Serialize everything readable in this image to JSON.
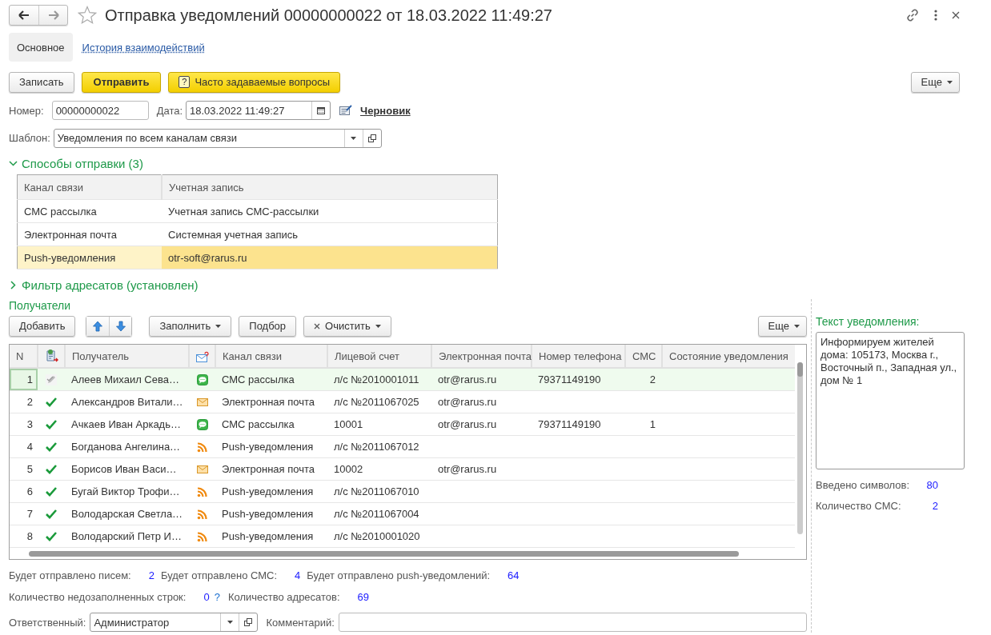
{
  "window": {
    "title": "Отправка уведомлений 00000000022 от 18.03.2022 11:49:27",
    "favorite": false
  },
  "tabs": [
    {
      "label": "Основное",
      "selected": true
    },
    {
      "label": "История взаимодействий",
      "selected": false
    }
  ],
  "toolbar": {
    "buttons": [
      {
        "label": "Записать",
        "kind": "plain"
      },
      {
        "label": "Отправить",
        "kind": "primary"
      },
      {
        "label": "Часто задаваемые вопросы",
        "kind": "help",
        "icon": "?"
      }
    ],
    "more": "Еще"
  },
  "number": {
    "label": "Номер:",
    "value": "00000000022"
  },
  "date": {
    "label": "Дата:",
    "value": "18.03.2022 11:49:27"
  },
  "state_link": "Черновик",
  "template": {
    "label": "Шаблон:",
    "value": "Уведомления по всем каналам связи"
  },
  "methods": {
    "title": "Способы отправки (3)",
    "expanded": true,
    "columns": [
      "Канал связи",
      "Учетная запись"
    ],
    "rows": [
      {
        "cells": [
          "СМС рассылка",
          "Учетная запись СМС-рассылки"
        ],
        "selected": false
      },
      {
        "cells": [
          "Электронная почта",
          "Системная учетная запись"
        ],
        "selected": false
      },
      {
        "cells": [
          "Push-уведомления",
          "otr-soft@rarus.ru"
        ],
        "selected": true
      }
    ]
  },
  "filter": {
    "title": "Фильтр адресатов (установлен)",
    "expanded": false
  },
  "recipients": {
    "title": "Получатели",
    "buttons": [
      {
        "label": "Добавить",
        "kind": "plain"
      },
      {
        "kind": "move"
      },
      {
        "label": "Заполнить",
        "kind": "menu"
      },
      {
        "label": "Подбор",
        "kind": "plain"
      },
      {
        "label": "Очистить",
        "kind": "clear"
      }
    ],
    "more": "Еще",
    "columns": [
      {
        "kind": "number",
        "label": "N"
      },
      {
        "kind": "status_icon"
      },
      {
        "kind": "text",
        "label": "Получатель"
      },
      {
        "kind": "channel_icon"
      },
      {
        "kind": "text",
        "label": "Канал связи"
      },
      {
        "kind": "text",
        "label": "Лицевой счет"
      },
      {
        "kind": "text",
        "label": "Электронная почта"
      },
      {
        "kind": "text",
        "label": "Номер телефона"
      },
      {
        "kind": "number",
        "label": "СМС"
      },
      {
        "kind": "text",
        "label": "Состояние уведомления"
      }
    ],
    "rows": [
      {
        "selected": true,
        "cells": [
          {
            "text": "1"
          },
          {
            "kind": "draft"
          },
          {
            "text": "Алеев Михаил Сева…"
          },
          {
            "kind": "sms"
          },
          {
            "text": "СМС рассылка"
          },
          {
            "text": "л/с №2010001011"
          },
          {
            "text": "otr@rarus.ru"
          },
          {
            "text": "79371149190"
          },
          {
            "text": "2"
          },
          {}
        ]
      },
      {
        "selected": false,
        "cells": [
          {
            "text": "2"
          },
          {
            "kind": "ok"
          },
          {
            "text": "Александров Витали…"
          },
          {
            "kind": "email"
          },
          {
            "text": "Электронная почта"
          },
          {
            "text": "л/с №2011067025"
          },
          {
            "text": "otr@rarus.ru"
          },
          {},
          {},
          {}
        ]
      },
      {
        "selected": false,
        "cells": [
          {
            "text": "3"
          },
          {
            "kind": "ok"
          },
          {
            "text": "Ачкаев Иван Аркадь…"
          },
          {
            "kind": "sms"
          },
          {
            "text": "СМС рассылка"
          },
          {
            "text": "10001"
          },
          {
            "text": "otr@rarus.ru"
          },
          {
            "text": "79371149190"
          },
          {
            "text": "1"
          },
          {}
        ]
      },
      {
        "selected": false,
        "cells": [
          {
            "text": "4"
          },
          {
            "kind": "ok"
          },
          {
            "text": "Богданова Ангелина…"
          },
          {
            "kind": "push"
          },
          {
            "text": "Push-уведомления"
          },
          {
            "text": "л/с №2011067012"
          },
          {},
          {},
          {},
          {}
        ]
      },
      {
        "selected": false,
        "cells": [
          {
            "text": "5"
          },
          {
            "kind": "ok"
          },
          {
            "text": "Борисов Иван Васи…"
          },
          {
            "kind": "email"
          },
          {
            "text": "Электронная почта"
          },
          {
            "text": "10002"
          },
          {
            "text": "otr@rarus.ru"
          },
          {},
          {},
          {}
        ]
      },
      {
        "selected": false,
        "cells": [
          {
            "text": "6"
          },
          {
            "kind": "ok"
          },
          {
            "text": "Бугай Виктор Трофи…"
          },
          {
            "kind": "push"
          },
          {
            "text": "Push-уведомления"
          },
          {
            "text": "л/с №2011067010"
          },
          {},
          {},
          {},
          {}
        ]
      },
      {
        "selected": false,
        "cells": [
          {
            "text": "7"
          },
          {
            "kind": "ok"
          },
          {
            "text": "Володарская Светла…"
          },
          {
            "kind": "push"
          },
          {
            "text": "Push-уведомления"
          },
          {
            "text": "л/с №2011067004"
          },
          {},
          {},
          {},
          {}
        ]
      },
      {
        "selected": false,
        "cells": [
          {
            "text": "8"
          },
          {
            "kind": "ok"
          },
          {
            "text": "Володарский Петр И…"
          },
          {
            "kind": "push"
          },
          {
            "text": "Push-уведомления"
          },
          {
            "text": "л/с №2010001020"
          },
          {},
          {},
          {},
          {}
        ]
      }
    ]
  },
  "summary": [
    [
      {
        "kind": "stat",
        "label": "Будет отправлено писем:",
        "value": "2"
      },
      {
        "kind": "stat",
        "label": "Будет отправлено СМС:",
        "value": "4"
      },
      {
        "kind": "stat",
        "label": "Будет отправлено push-уведомлений:",
        "value": "64"
      }
    ],
    [
      {
        "kind": "stat",
        "label": "Количество недозаполненных строк:",
        "value": "0"
      },
      {
        "kind": "help",
        "text": "?"
      },
      {
        "kind": "stat",
        "label": "Количество адресатов:",
        "value": "69"
      }
    ]
  ],
  "responsible": {
    "label": "Ответственный:",
    "value": "Администратор"
  },
  "comment": {
    "label": "Комментарий:"
  },
  "message": {
    "title": "Текст уведомления:",
    "text": "Информируем жителей дома: 105173, Москва г., Восточный п., Западная ул., дом № 1",
    "stats": [
      {
        "label": "Введено символов:",
        "value": "80"
      },
      {
        "label": "Количество СМС:",
        "value": "2"
      }
    ]
  }
}
